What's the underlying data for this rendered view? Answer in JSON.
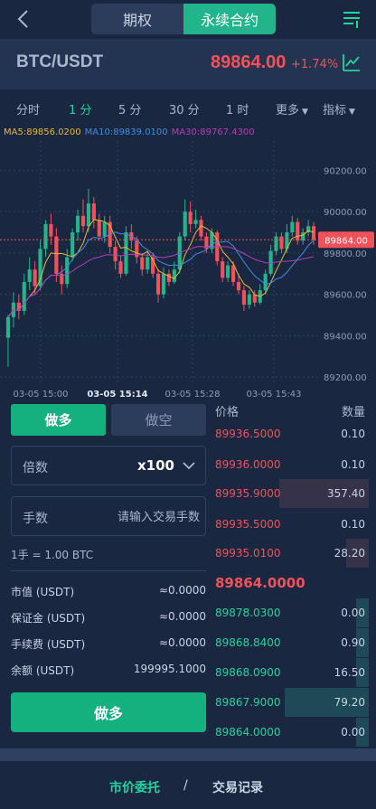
{
  "header": {
    "tabs": [
      {
        "label": "期权",
        "active": false
      },
      {
        "label": "永续合约",
        "active": true
      }
    ]
  },
  "pair": {
    "name": "BTC/USDT",
    "price": "89864.00",
    "change": "+1.74%"
  },
  "timeframes": [
    {
      "label": "分时",
      "active": false
    },
    {
      "label": "1 分",
      "active": true
    },
    {
      "label": "5 分",
      "active": false
    },
    {
      "label": "30 分",
      "active": false
    },
    {
      "label": "1 时",
      "active": false
    },
    {
      "label": "更多",
      "active": false
    },
    {
      "label": "指标",
      "active": false
    }
  ],
  "indicators": {
    "ma5": "MA5:89856.0200",
    "ma10": "MA10:89839.0100",
    "ma30": "MA30:89767.4300"
  },
  "chart_data": {
    "type": "candlestick",
    "y_ticks": [
      "90200.00",
      "90000.00",
      "89800.00",
      "89600.00",
      "89400.00",
      "89200.00"
    ],
    "ylim": [
      89170,
      90320
    ],
    "x_ticks": [
      {
        "label": "03-05 15:00",
        "bold": false
      },
      {
        "label": "03-05 15:14",
        "bold": true
      },
      {
        "label": "03-05 15:28",
        "bold": false
      },
      {
        "label": "03-05 15:43",
        "bold": false
      }
    ],
    "current_price_label": "89864.00",
    "current_price": 89864,
    "candles": [
      [
        89390,
        89490,
        89250,
        89500
      ],
      [
        89490,
        89560,
        89440,
        89610
      ],
      [
        89560,
        89520,
        89480,
        89600
      ],
      [
        89520,
        89660,
        89500,
        89700
      ],
      [
        89660,
        89720,
        89620,
        89780
      ],
      [
        89720,
        89640,
        89600,
        89760
      ],
      [
        89640,
        89820,
        89620,
        89860
      ],
      [
        89820,
        89940,
        89780,
        89960
      ],
      [
        89940,
        89880,
        89840,
        89990
      ],
      [
        89880,
        89700,
        89660,
        89920
      ],
      [
        89700,
        89650,
        89600,
        89740
      ],
      [
        89650,
        89780,
        89630,
        89820
      ],
      [
        89780,
        89900,
        89760,
        89920
      ],
      [
        89900,
        89980,
        89860,
        90010
      ],
      [
        89980,
        89930,
        89900,
        90060
      ],
      [
        89930,
        90040,
        89900,
        90110
      ],
      [
        90040,
        89960,
        89920,
        90070
      ],
      [
        89960,
        89880,
        89860,
        89990
      ],
      [
        89880,
        89950,
        89850,
        89980
      ],
      [
        89950,
        89830,
        89800,
        89980
      ],
      [
        89830,
        89760,
        89720,
        89860
      ],
      [
        89760,
        89700,
        89680,
        89790
      ],
      [
        89700,
        89900,
        89690,
        89930
      ],
      [
        89900,
        89860,
        89820,
        89940
      ],
      [
        89860,
        89780,
        89750,
        89880
      ],
      [
        89780,
        89720,
        89690,
        89800
      ],
      [
        89720,
        89780,
        89700,
        89810
      ],
      [
        89780,
        89700,
        89680,
        89800
      ],
      [
        89700,
        89600,
        89560,
        89720
      ],
      [
        89600,
        89700,
        89580,
        89730
      ],
      [
        89700,
        89660,
        89640,
        89720
      ],
      [
        89660,
        89720,
        89650,
        89760
      ],
      [
        89720,
        89880,
        89700,
        89900
      ],
      [
        89880,
        90000,
        89860,
        90060
      ],
      [
        90000,
        89940,
        89900,
        90050
      ],
      [
        89940,
        89960,
        89920,
        90010
      ],
      [
        89960,
        89880,
        89860,
        89980
      ],
      [
        89880,
        89820,
        89800,
        89900
      ],
      [
        89820,
        89900,
        89800,
        89920
      ],
      [
        89900,
        89760,
        89740,
        89910
      ],
      [
        89760,
        89680,
        89660,
        89780
      ],
      [
        89680,
        89740,
        89660,
        89760
      ],
      [
        89740,
        89660,
        89640,
        89760
      ],
      [
        89660,
        89620,
        89600,
        89700
      ],
      [
        89620,
        89550,
        89520,
        89640
      ],
      [
        89550,
        89600,
        89530,
        89620
      ],
      [
        89600,
        89560,
        89540,
        89620
      ],
      [
        89560,
        89620,
        89550,
        89650
      ],
      [
        89620,
        89700,
        89600,
        89720
      ],
      [
        89700,
        89810,
        89690,
        89840
      ],
      [
        89810,
        89880,
        89790,
        89900
      ],
      [
        89880,
        89820,
        89800,
        89900
      ],
      [
        89820,
        89900,
        89800,
        89940
      ],
      [
        89900,
        89950,
        89880,
        89980
      ],
      [
        89950,
        89860,
        89840,
        89970
      ],
      [
        89860,
        89900,
        89840,
        89920
      ],
      [
        89900,
        89930,
        89880,
        89960
      ],
      [
        89930,
        89864,
        89840,
        89950
      ]
    ]
  },
  "trade": {
    "long_label": "做多",
    "short_label": "做空",
    "leverage_label": "倍数",
    "leverage_value": "x100",
    "qty_label": "手数",
    "qty_placeholder": "请输入交易手数",
    "lot_info": "1手 = 1.00 BTC",
    "stats": [
      {
        "label": "市值 (USDT)",
        "value": "≈0.0000"
      },
      {
        "label": "保证金 (USDT)",
        "value": "≈0.0000"
      },
      {
        "label": "手续费 (USDT)",
        "value": "≈0.0000"
      },
      {
        "label": "余额 (USDT)",
        "value": "199995.1000"
      }
    ],
    "submit_label": "做多"
  },
  "orderbook": {
    "price_header": "价格",
    "qty_header": "数量",
    "asks": [
      {
        "price": "89936.5000",
        "qty": "0.10",
        "depth": 0.0
      },
      {
        "price": "89936.0000",
        "qty": "0.10",
        "depth": 0.0
      },
      {
        "price": "89935.9000",
        "qty": "357.40",
        "depth": 0.58
      },
      {
        "price": "89935.5000",
        "qty": "0.10",
        "depth": 0.0
      },
      {
        "price": "89935.0100",
        "qty": "28.20",
        "depth": 0.15
      }
    ],
    "last_price": "89864.0000",
    "bids": [
      {
        "price": "89878.0300",
        "qty": "0.00",
        "depth": 0.08
      },
      {
        "price": "89868.8400",
        "qty": "0.90",
        "depth": 0.08
      },
      {
        "price": "89868.0900",
        "qty": "16.50",
        "depth": 0.08
      },
      {
        "price": "89867.9000",
        "qty": "79.20",
        "depth": 0.55
      },
      {
        "price": "89864.0000",
        "qty": "0.00",
        "depth": 0.08
      }
    ]
  },
  "bottom_nav": {
    "active_label": "市价委托",
    "separator": "/",
    "other_label": "交易记录"
  },
  "colors": {
    "up": "#22b58b",
    "down": "#f1525a",
    "accent": "#22d3a0",
    "ma5": "#e8b931",
    "ma10": "#3b8fe0",
    "ma30": "#b03fb8"
  }
}
